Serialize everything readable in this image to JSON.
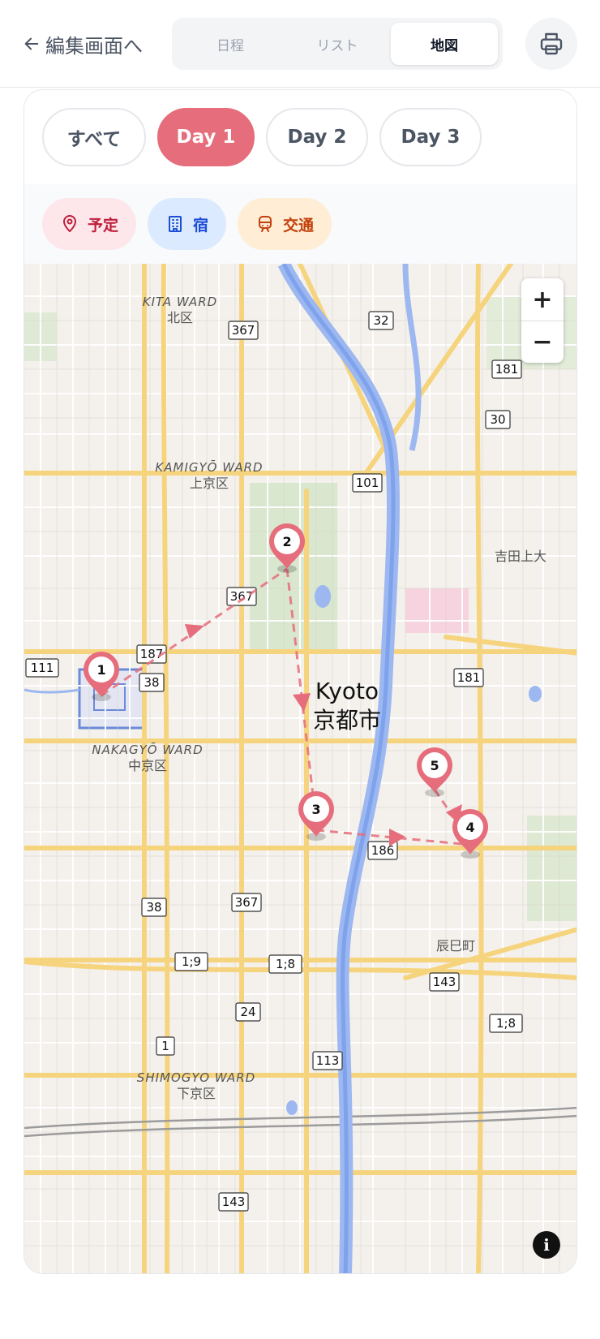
{
  "header": {
    "back_label": "編集画面へ",
    "tabs": [
      {
        "label": "日程",
        "active": false
      },
      {
        "label": "リスト",
        "active": false
      },
      {
        "label": "地図",
        "active": true
      }
    ],
    "print_icon": "printer-icon"
  },
  "day_filters": [
    {
      "label": "すべて",
      "active": false
    },
    {
      "label": "Day 1",
      "active": true
    },
    {
      "label": "Day 2",
      "active": false
    },
    {
      "label": "Day 3",
      "active": false
    }
  ],
  "legend": {
    "plan": {
      "label": "予定",
      "icon": "map-pin-icon",
      "color": "#be1e3c"
    },
    "stay": {
      "label": "宿",
      "icon": "building-icon",
      "color": "#1d4ed8"
    },
    "transport": {
      "label": "交通",
      "icon": "train-icon",
      "color": "#c2410c"
    }
  },
  "map": {
    "city_label_en": "Kyoto",
    "city_label_ja": "京都市",
    "wards": [
      {
        "en": "KITA WARD",
        "ja": "北区"
      },
      {
        "en": "KAMIGYŌ WARD",
        "ja": "上京区"
      },
      {
        "en": "NAKAGYŌ WARD",
        "ja": "中京区"
      },
      {
        "en": "SHIMOGYO WARD",
        "ja": "下京区"
      }
    ],
    "place_labels": [
      "吉田上大",
      "辰巳町"
    ],
    "route_shields": [
      "367",
      "32",
      "181",
      "30",
      "101",
      "367",
      "187",
      "38",
      "111",
      "181",
      "186",
      "38",
      "367",
      "1;9",
      "1;8",
      "143",
      "24",
      "1;8",
      "1",
      "113",
      "143"
    ],
    "markers": [
      "1",
      "2",
      "3",
      "4",
      "5"
    ],
    "zoom_in": "+",
    "zoom_out": "−",
    "info": "i",
    "route_color": "#e66d7b"
  }
}
